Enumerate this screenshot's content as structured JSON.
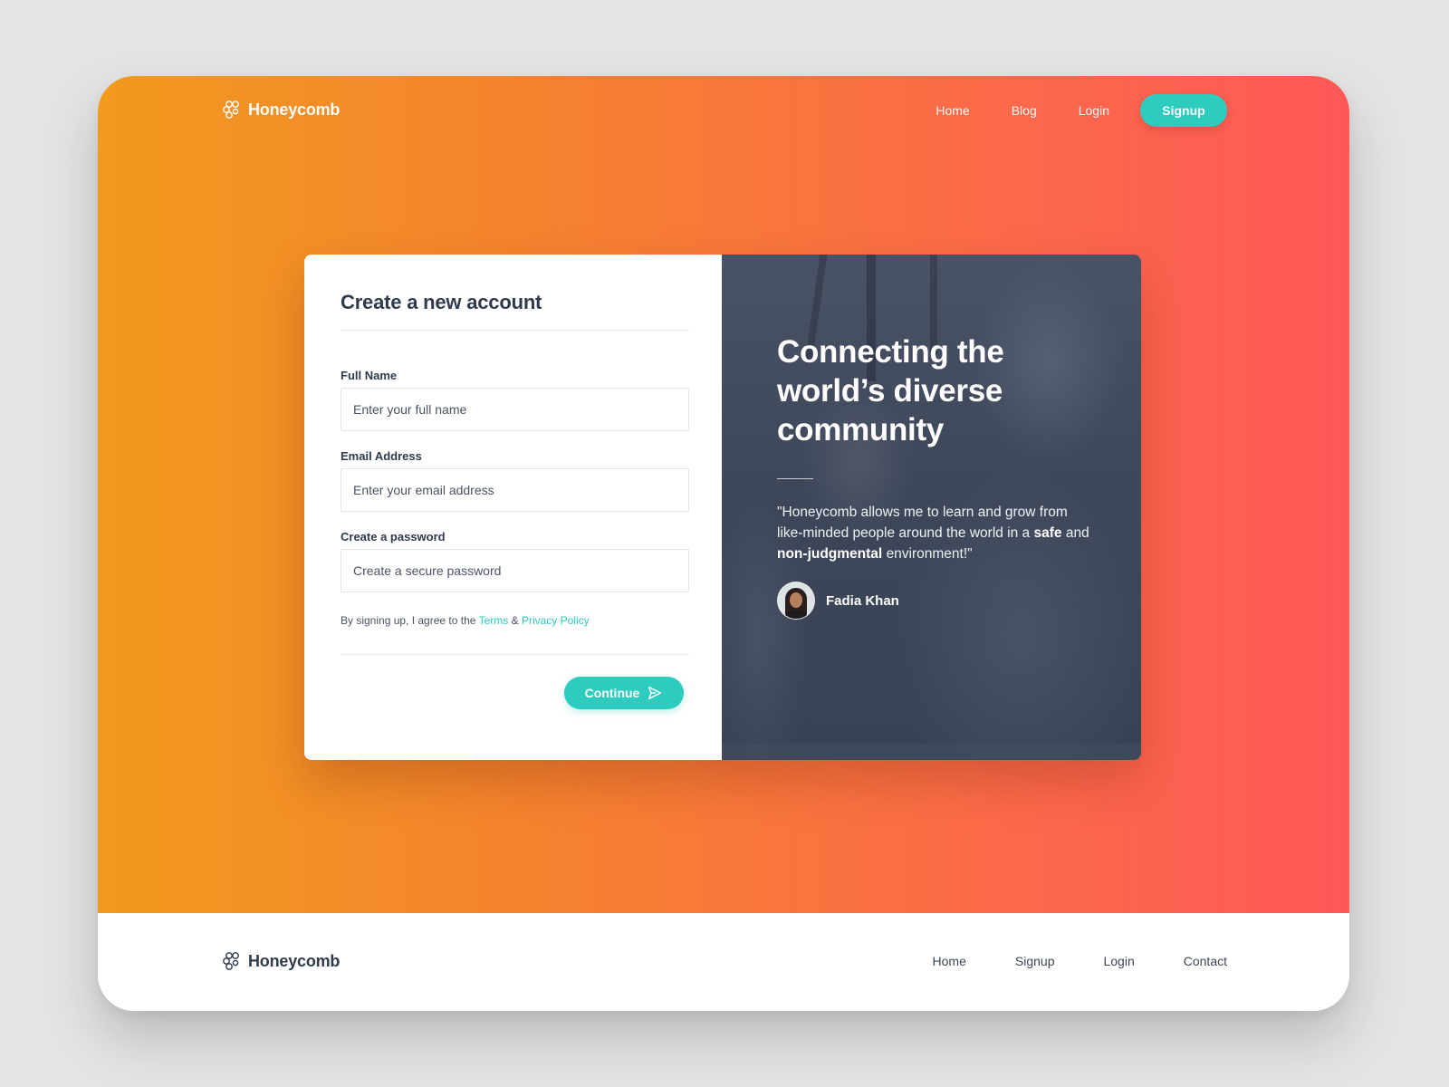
{
  "brand": {
    "name": "Honeycomb",
    "accent_color": "#2ecbbf",
    "gradient_start": "#f19a1e",
    "gradient_end": "#ff5858",
    "logo_icon": "honeycomb-cells-icon"
  },
  "header": {
    "nav": [
      {
        "label": "Home"
      },
      {
        "label": "Blog"
      },
      {
        "label": "Login"
      }
    ],
    "signup_label": "Signup"
  },
  "form": {
    "title": "Create a new account",
    "fields": [
      {
        "label": "Full Name",
        "placeholder": "Enter your full name",
        "value": ""
      },
      {
        "label": "Email Address",
        "placeholder": "Enter your email address",
        "value": ""
      },
      {
        "label": "Create a password",
        "placeholder": "Create a secure password",
        "value": ""
      }
    ],
    "terms": {
      "prefix": "By signing up, I agree to the",
      "terms_link": "Terms",
      "ampersand": "&",
      "privacy_link": "Privacy Policy"
    },
    "continue_label": "Continue",
    "continue_icon": "send-icon"
  },
  "testimonial": {
    "headline": "Connecting the world’s diverse community",
    "quote_part1": "\"Honeycomb allows me to learn and grow from like-minded people around the world in a",
    "quote_bold1": "safe",
    "quote_part2": "and",
    "quote_bold2": "non-judgmental",
    "quote_part3": "environment!\"",
    "author_name": "Fadia Khan"
  },
  "footer": {
    "nav": [
      {
        "label": "Home"
      },
      {
        "label": "Signup"
      },
      {
        "label": "Login"
      },
      {
        "label": "Contact"
      }
    ]
  }
}
